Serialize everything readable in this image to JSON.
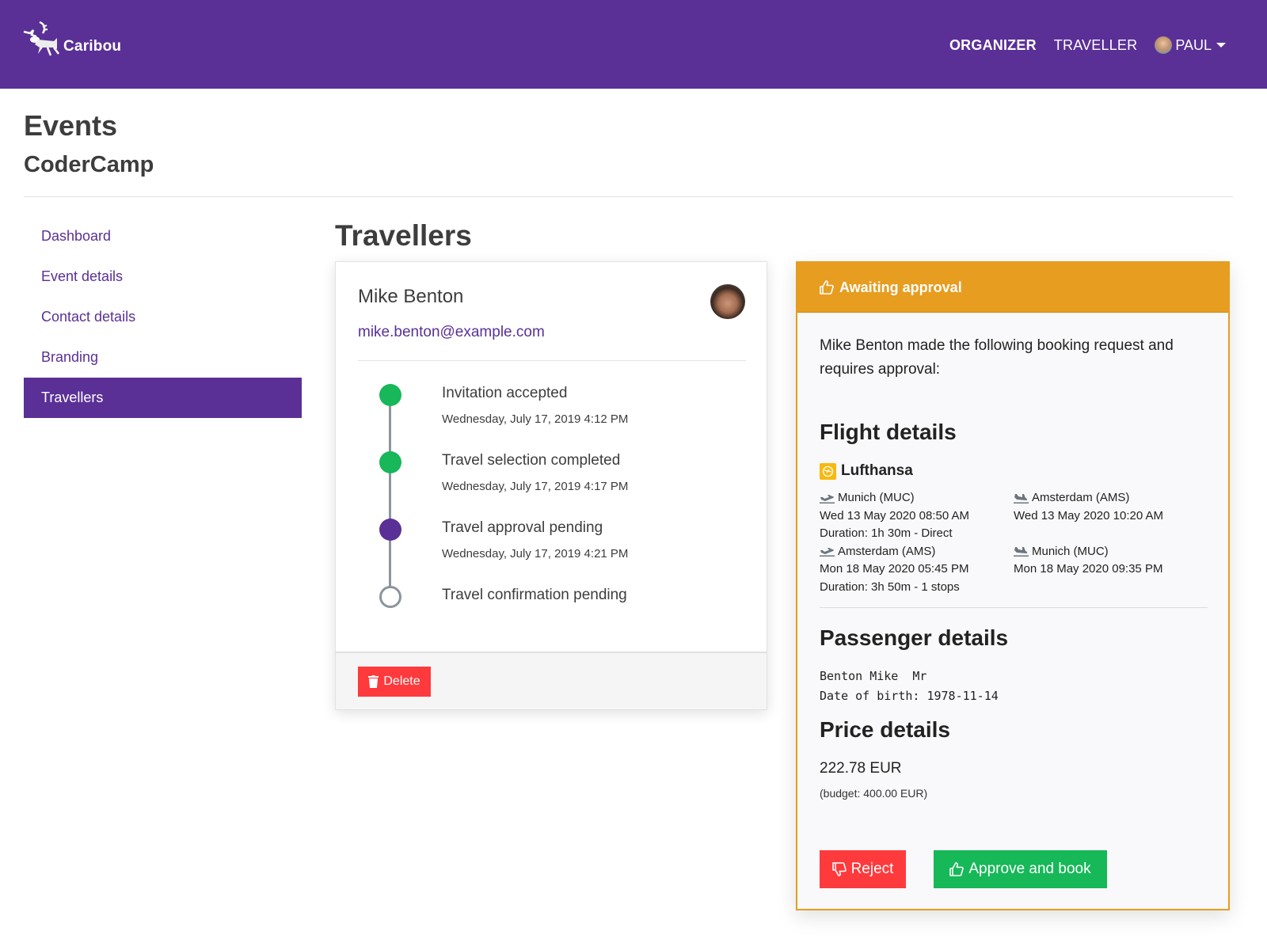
{
  "navbar": {
    "brand": "Caribou",
    "links": [
      {
        "label": "ORGANIZER",
        "active": true
      },
      {
        "label": "TRAVELLER",
        "active": false
      }
    ],
    "user": {
      "name": "PAUL"
    }
  },
  "header": {
    "title": "Events",
    "event_name": "CoderCamp"
  },
  "sidebar": {
    "items": [
      {
        "label": "Dashboard",
        "active": false
      },
      {
        "label": "Event details",
        "active": false
      },
      {
        "label": "Contact details",
        "active": false
      },
      {
        "label": "Branding",
        "active": false
      },
      {
        "label": "Travellers",
        "active": true
      }
    ]
  },
  "main": {
    "section_title": "Travellers",
    "traveller": {
      "name": "Mike Benton",
      "email": "mike.benton@example.com",
      "timeline": [
        {
          "label": "Invitation accepted",
          "time": "Wednesday, July 17, 2019 4:12 PM",
          "status": "done"
        },
        {
          "label": "Travel selection completed",
          "time": "Wednesday, July 17, 2019 4:17 PM",
          "status": "done"
        },
        {
          "label": "Travel approval pending",
          "time": "Wednesday, July 17, 2019 4:21 PM",
          "status": "current"
        },
        {
          "label": "Travel confirmation pending",
          "time": "",
          "status": "pending"
        }
      ],
      "delete_label": "Delete"
    },
    "approval": {
      "header": "Awaiting approval",
      "intro": "Mike Benton made the following booking request and requires approval:",
      "flight_title": "Flight details",
      "airline": "Lufthansa",
      "legs": [
        {
          "departure": {
            "place": "Munich (MUC)",
            "time": "Wed 13 May 2020 08:50 AM"
          },
          "arrival": {
            "place": "Amsterdam (AMS)",
            "time": "Wed 13 May 2020 10:20 AM"
          },
          "duration": "Duration: 1h 30m - Direct"
        },
        {
          "departure": {
            "place": "Amsterdam (AMS)",
            "time": "Mon 18 May 2020 05:45 PM"
          },
          "arrival": {
            "place": "Munich (MUC)",
            "time": "Mon 18 May 2020 09:35 PM"
          },
          "duration": "Duration: 3h 50m - 1 stops"
        }
      ],
      "passenger_title": "Passenger details",
      "passenger_name": "Benton Mike  Mr",
      "passenger_dob": "Date of birth: 1978-11-14",
      "price_title": "Price details",
      "price": "222.78 EUR",
      "budget": "(budget: 400.00 EUR)",
      "reject_label": "Reject",
      "approve_label": "Approve and book"
    }
  },
  "colors": {
    "brand": "#5a3096",
    "warning": "#e79d20",
    "danger": "#fe3a3d",
    "success": "#16b858",
    "timeline_done": "#17b75a"
  }
}
